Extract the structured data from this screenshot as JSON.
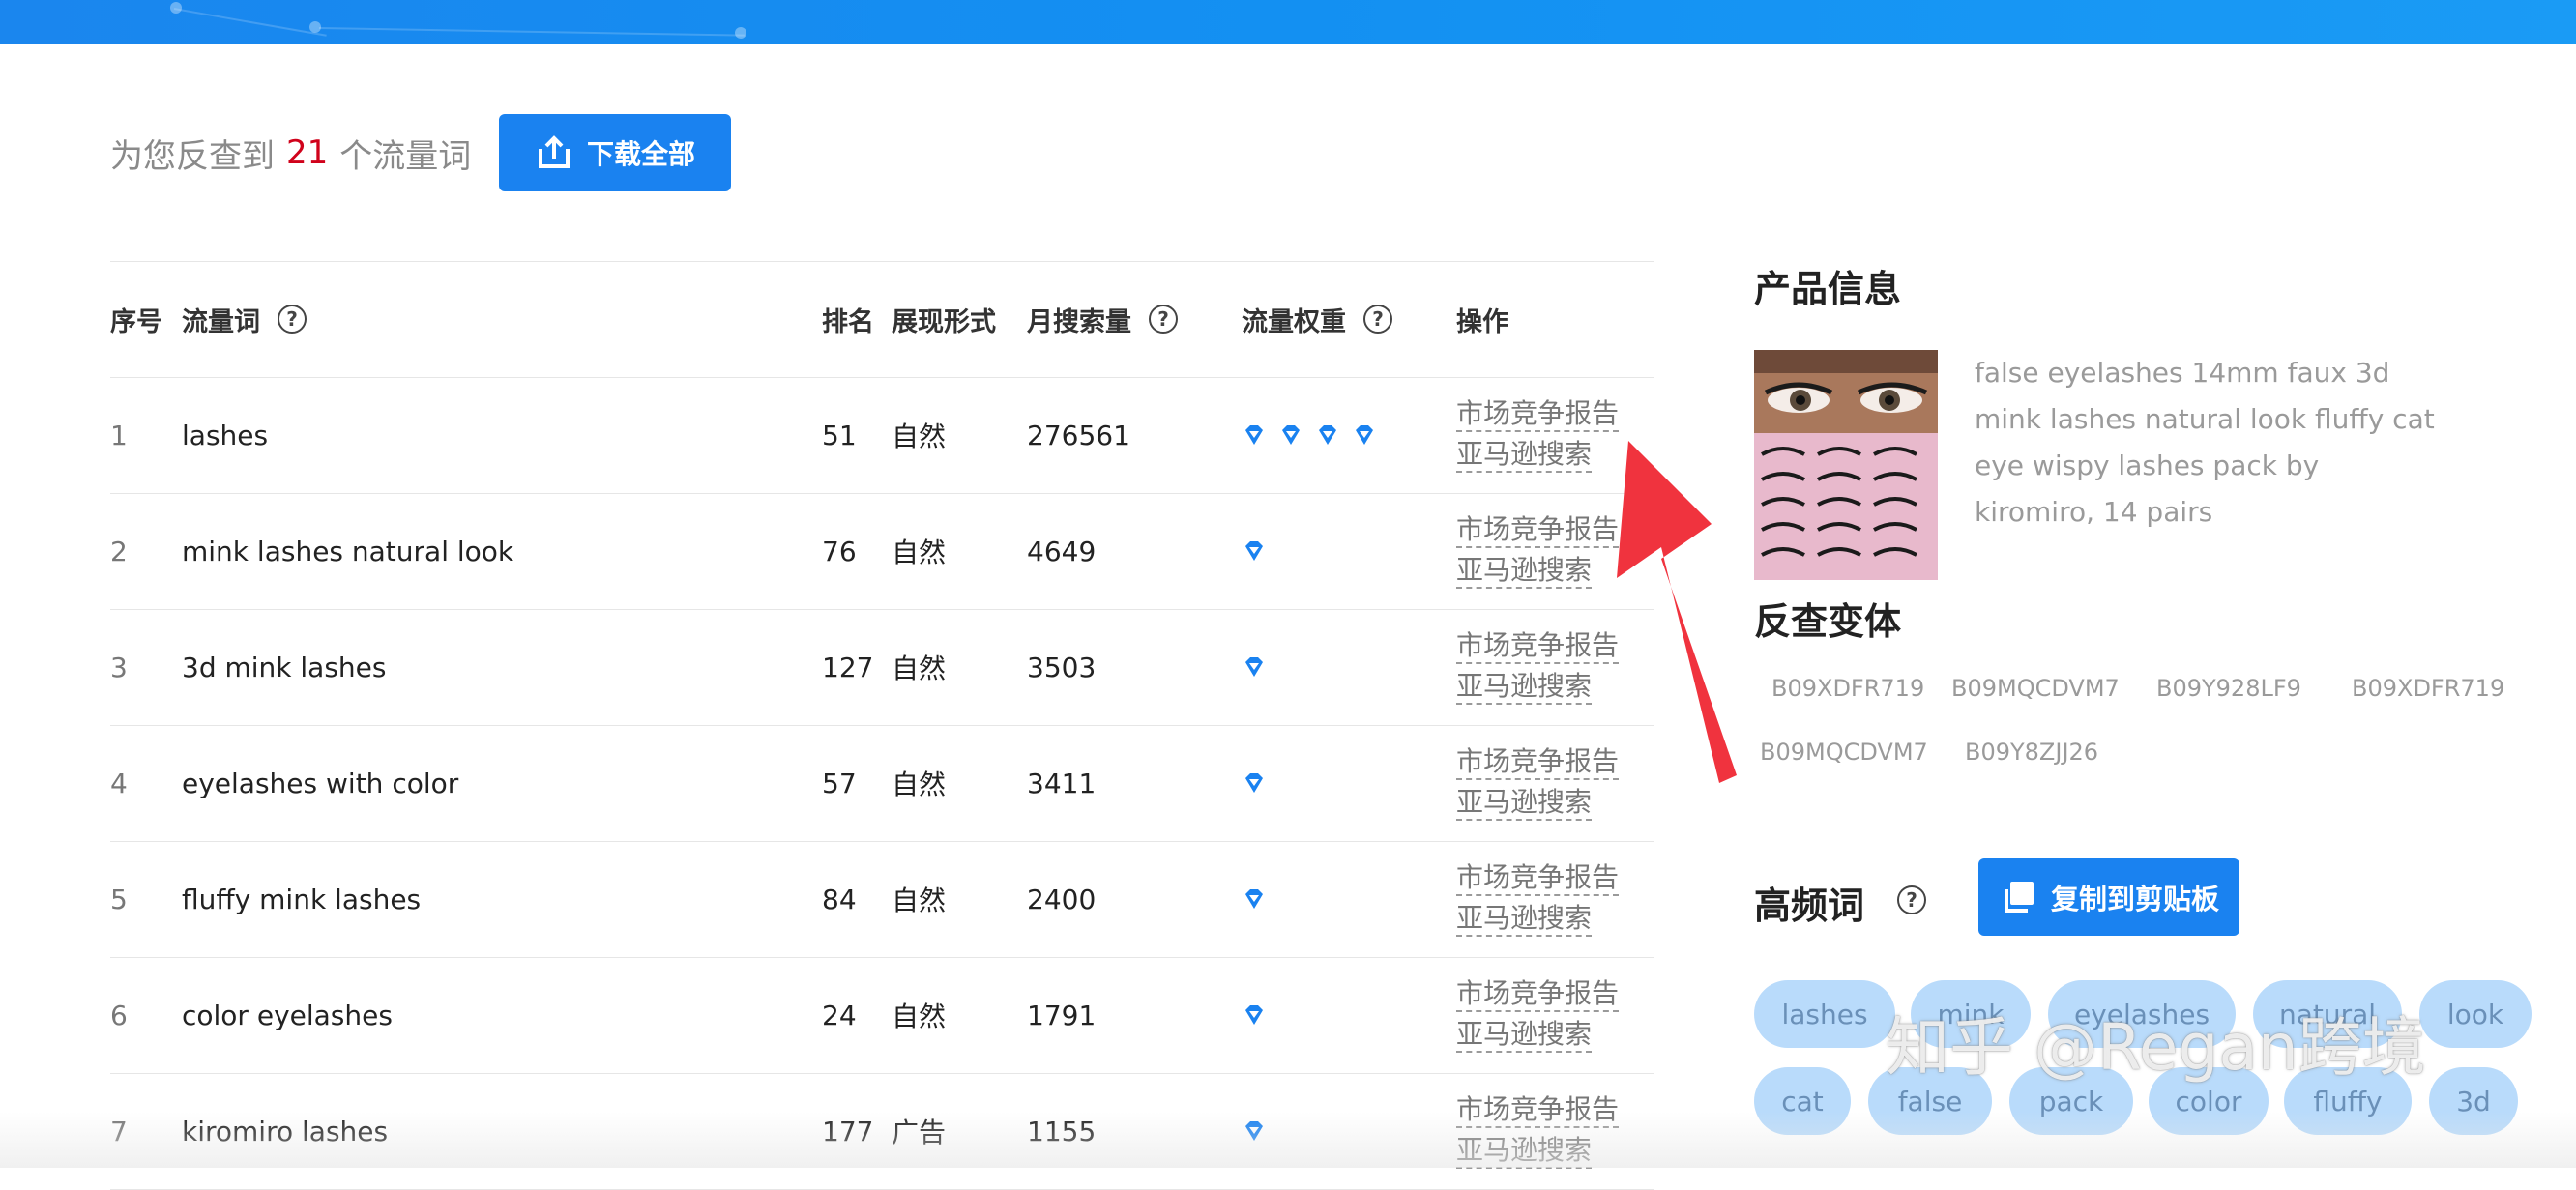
{
  "summary": {
    "prefix": "为您反查到",
    "count": "21",
    "suffix": "个流量词",
    "download_label": "下载全部"
  },
  "table": {
    "headers": {
      "no": "序号",
      "keyword": "流量词",
      "rank": "排名",
      "display": "展现形式",
      "monthly": "月搜索量",
      "weight": "流量权重",
      "ops": "操作"
    },
    "op_labels": {
      "market": "市场竞争报告",
      "amazon": "亚马逊搜索"
    },
    "rows": [
      {
        "no": "1",
        "keyword": "lashes",
        "rank": "51",
        "display": "自然",
        "monthly": "276561",
        "weight": 4
      },
      {
        "no": "2",
        "keyword": "mink lashes natural look",
        "rank": "76",
        "display": "自然",
        "monthly": "4649",
        "weight": 1
      },
      {
        "no": "3",
        "keyword": "3d mink lashes",
        "rank": "127",
        "display": "自然",
        "monthly": "3503",
        "weight": 1
      },
      {
        "no": "4",
        "keyword": "eyelashes with color",
        "rank": "57",
        "display": "自然",
        "monthly": "3411",
        "weight": 1
      },
      {
        "no": "5",
        "keyword": "fluffy mink lashes",
        "rank": "84",
        "display": "自然",
        "monthly": "2400",
        "weight": 1
      },
      {
        "no": "6",
        "keyword": "color eyelashes",
        "rank": "24",
        "display": "自然",
        "monthly": "1791",
        "weight": 1
      },
      {
        "no": "7",
        "keyword": "kiromiro lashes",
        "rank": "177",
        "display": "广告",
        "monthly": "1155",
        "weight": 1
      }
    ]
  },
  "product": {
    "title": "产品信息",
    "description": "false eyelashes 14mm faux 3d mink lashes natural look fluffy cat eye wispy lashes pack by kiromiro, 14 pairs"
  },
  "variants": {
    "title": "反查变体",
    "items": [
      "B09XDFR719",
      "B09MQCDVM7",
      "B09Y928LF9",
      "B09XDFR719",
      "B09MQCDVM7",
      "B09Y8ZJJ26"
    ]
  },
  "keywords": {
    "title": "高频词",
    "copy_label": "复制到剪贴板",
    "tags": [
      "lashes",
      "mink",
      "eyelashes",
      "natural",
      "look",
      "cat",
      "false",
      "pack",
      "color",
      "fluffy",
      "3d"
    ]
  },
  "watermark": "知乎 @Regan跨境",
  "colors": {
    "primary": "#1a82f0",
    "accent_count": "#d0021b",
    "annotation_arrow": "#f0333e",
    "tag_bg": "#b9dbfb"
  }
}
